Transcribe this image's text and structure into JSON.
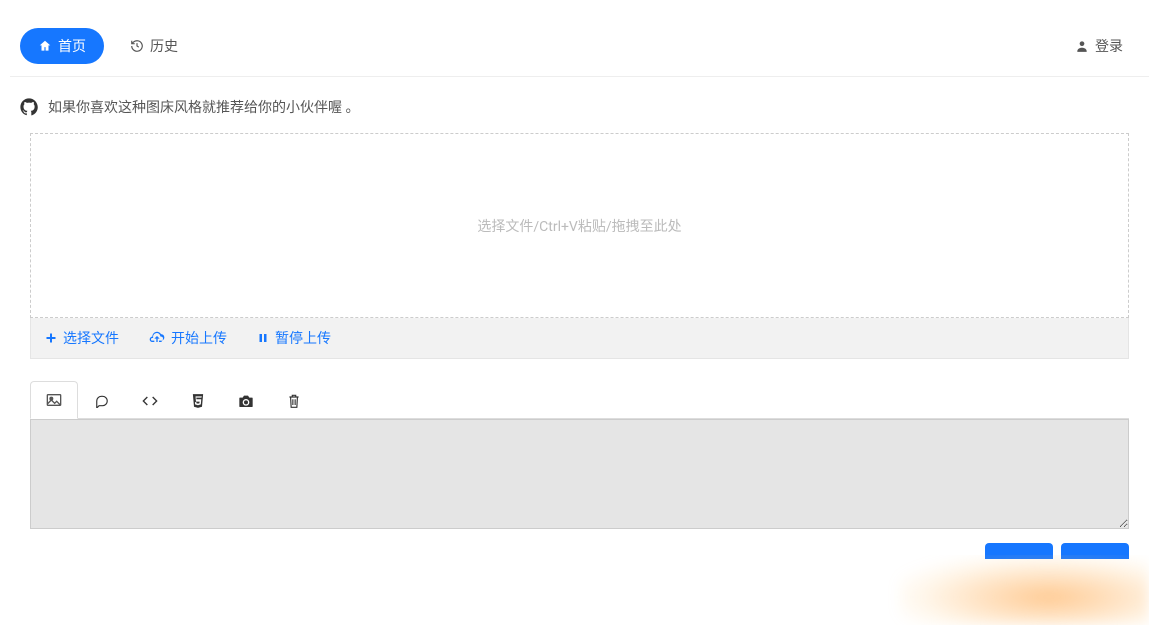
{
  "nav": {
    "home_label": "首页",
    "history_label": "历史",
    "login_label": "登录"
  },
  "promo": {
    "text": "如果你喜欢这种图床风格就推荐给你的小伙伴喔 。"
  },
  "upload": {
    "dropzone_hint": "选择文件/Ctrl+V粘贴/拖拽至此处",
    "select_label": "选择文件",
    "start_label": "开始上传",
    "pause_label": "暂停上传"
  },
  "tabs": {
    "image": "image",
    "comment": "comment",
    "code": "code",
    "html5": "html5",
    "camera": "camera",
    "delete": "delete"
  },
  "output": {
    "value": ""
  }
}
